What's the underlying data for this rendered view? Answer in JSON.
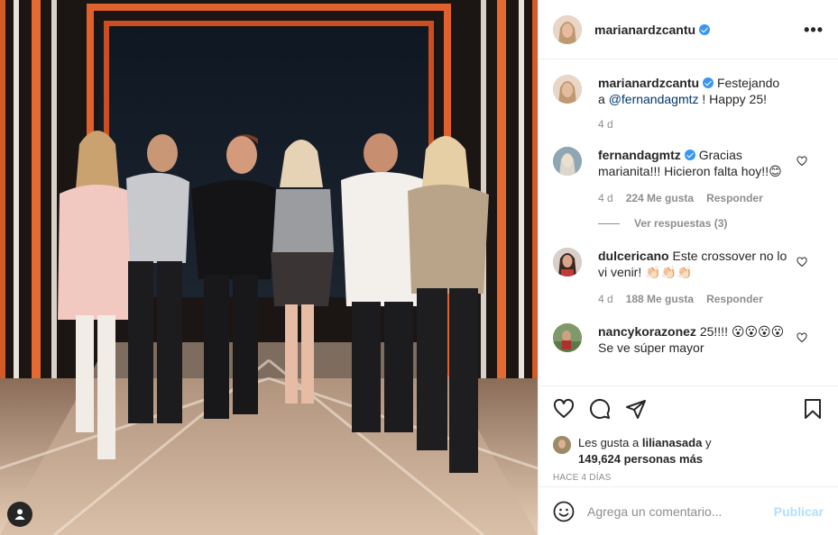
{
  "post": {
    "author": "marianardzcantu",
    "photo_alt": "Group photo"
  },
  "caption": {
    "username": "marianardzcantu",
    "text": "Festejando a",
    "mention": "@fernandagmtz",
    "text_after": "! Happy 25!",
    "time": "4 d"
  },
  "comments": [
    {
      "username": "fernandagmtz",
      "verified": true,
      "text": "Gracias marianita!!! Hicieron falta hoy!!😊",
      "time": "4 d",
      "likes": "224 Me gusta",
      "reply_label": "Responder",
      "view_replies": "Ver respuestas (3)"
    },
    {
      "username": "dulcericano",
      "verified": false,
      "text": "Este crossover no lo vi venir! 👏🏻👏🏻👏🏻",
      "time": "4 d",
      "likes": "188 Me gusta",
      "reply_label": "Responder"
    },
    {
      "username": "nancykorazonez",
      "verified": false,
      "text": "25!!!! 😮😮😮😮 Se ve súper mayor"
    }
  ],
  "likes": {
    "prefix": "Les gusta a",
    "first_user": "lilianasada",
    "connector": "y",
    "others": "149,624 personas más"
  },
  "date": "HACE 4 DÍAS",
  "add_comment": {
    "placeholder": "Agrega un comentario...",
    "publish_label": "Publicar"
  },
  "colors": {
    "verified": "#3897f0",
    "publish_disabled": "#b2dffc",
    "meta_gray": "#8e8e8e",
    "mention": "#00376b"
  }
}
